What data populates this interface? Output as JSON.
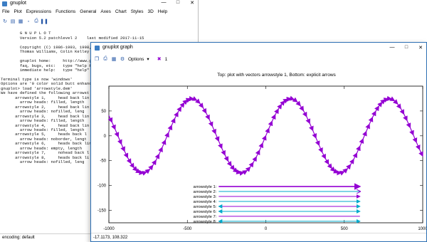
{
  "main_window": {
    "title": "gnuplot",
    "menu": [
      "File",
      "Plot",
      "Expressions",
      "Functions",
      "General",
      "Axes",
      "Chart",
      "Styles",
      "3D",
      "Help"
    ],
    "console_lines": [
      "",
      "        G N U P L O T",
      "        Version 5.2 patchlevel 2    last modified 2017-11-15",
      "",
      "        Copyright (C) 1986-1993, 1998,",
      "        Thomas Williams, Colin Kelley",
      "",
      "        gnuplot home:     http://www.g",
      "        faq, bugs, etc:   type \"help F",
      "        immediate help:   type \"help\"",
      "",
      "Terminal type is now 'windows'",
      "Options are '0 color solid butt enhanc",
      "gnuplot> load 'arrowstyle.dem'",
      "We have defined the following arrowst",
      "      arrowstyle 1,     head back lin",
      "        arrow heads: filled, length",
      "      arrowstyle 2,     head back lin",
      "        arrow heads: nofilled, leng",
      "      arrowstyle 3,     head back lin",
      "        arrow heads: filled, length",
      "      arrowstyle 4,     head back lin",
      "        arrow heads: filled, length",
      "      arrowstyle 5,     heads back l",
      "        arrow heads: noborder, lengt",
      "      arrowstyle 6,     heads back lin",
      "        arrow heads: empty, length",
      "      arrowstyle 7,     nohead back l",
      "      arrowstyle 8,     heads back li",
      "        arrow heads: nofilled, leng"
    ],
    "status": "encoding: default"
  },
  "graph_window": {
    "title": "gnuplot graph",
    "options_label": "Options",
    "toolbar_extra": "1",
    "status": "-17.1173,   108.322"
  },
  "chart_data": {
    "type": "line",
    "title": "Top: plot with vectors arrowstyle 1,  Bottom: explicit arrows",
    "xlim": [
      -1000,
      1000
    ],
    "ylim": [
      -175,
      100
    ],
    "xticks": [
      -1000,
      -500,
      0,
      500,
      1000
    ],
    "yticks": [
      50,
      0,
      -50,
      -100,
      -150
    ],
    "series": [
      {
        "function": "75*sin(x/100)",
        "samples_step": 20
      }
    ],
    "explicit_arrows": [
      {
        "label": "arrowstyle 1:",
        "y": -102,
        "head": "filled"
      },
      {
        "label": "arrowstyle 2:",
        "y": -112,
        "head": "nofilled"
      },
      {
        "label": "arrowstyle 3:",
        "y": -122,
        "head": "filled"
      },
      {
        "label": "arrowstyle 4:",
        "y": -132,
        "head": "filled"
      },
      {
        "label": "arrowstyle 5:",
        "y": -142,
        "head": "heads-noborder"
      },
      {
        "label": "arrowstyle 6:",
        "y": -152,
        "head": "heads-empty"
      },
      {
        "label": "arrowstyle 7:",
        "y": -162,
        "head": "nohead"
      },
      {
        "label": "arrowstyle 8:",
        "y": -172,
        "head": "heads-nofilled"
      }
    ],
    "colors": {
      "vectors": "#9400d3",
      "arrows_a": "#9400d3",
      "arrows_b": "#00aacc"
    }
  }
}
